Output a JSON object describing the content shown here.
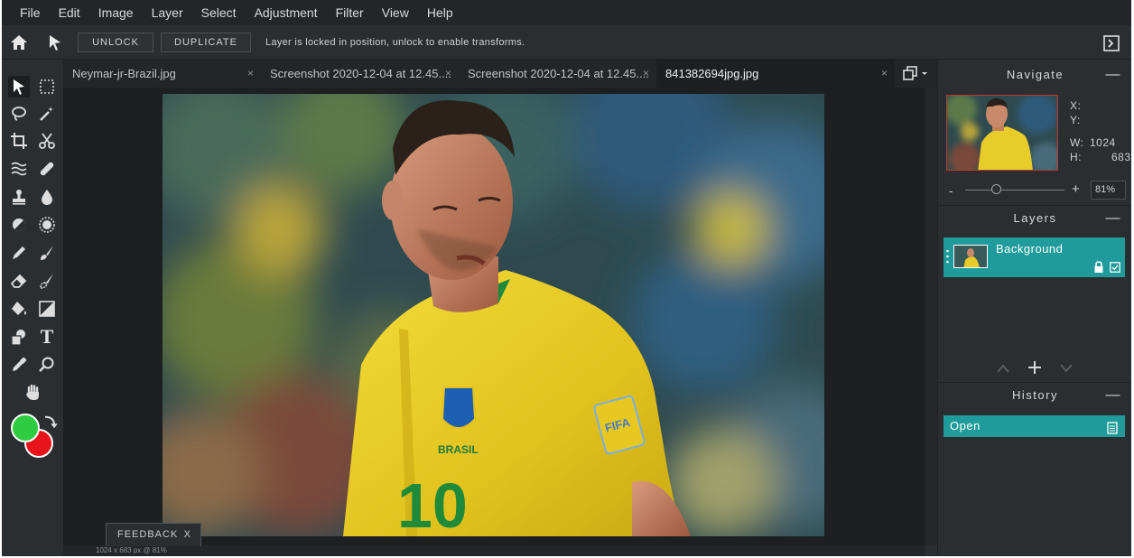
{
  "menu": [
    "File",
    "Edit",
    "Image",
    "Layer",
    "Select",
    "Adjustment",
    "Filter",
    "View",
    "Help"
  ],
  "options": {
    "unlock_label": "UNLOCK",
    "duplicate_label": "DUPLICATE",
    "hint": "Layer is locked in position, unlock to enable transforms."
  },
  "tabs": [
    {
      "label": "Neymar-jr-Brazil.jpg",
      "close": "×",
      "active": false
    },
    {
      "label": "Screenshot 2020-12-04 at 12.45....",
      "close": "×",
      "active": false
    },
    {
      "label": "Screenshot 2020-12-04 at 12.45....",
      "close": "×",
      "active": false
    },
    {
      "label": "841382694jpg.jpg",
      "close": "×",
      "active": true
    }
  ],
  "status": "1024 x 683 px @ 81%",
  "feedback": {
    "label": "FEEDBACK",
    "close": "X"
  },
  "colors": {
    "foreground": "#2ecc40",
    "background": "#e8141b",
    "accent": "#1e9b9a"
  },
  "navigate": {
    "title": "Navigate",
    "x_label": "X:",
    "y_label": "Y:",
    "w_label": "W:",
    "w_value": "1024",
    "h_label": "H:",
    "h_value": "683",
    "zoom_minus": "-",
    "zoom_plus": "+",
    "zoom_value": "81%",
    "zoom_percent": 81
  },
  "layers": {
    "title": "Layers",
    "items": [
      {
        "name": "Background"
      }
    ]
  },
  "history": {
    "title": "History",
    "items": [
      {
        "label": "Open"
      }
    ]
  }
}
